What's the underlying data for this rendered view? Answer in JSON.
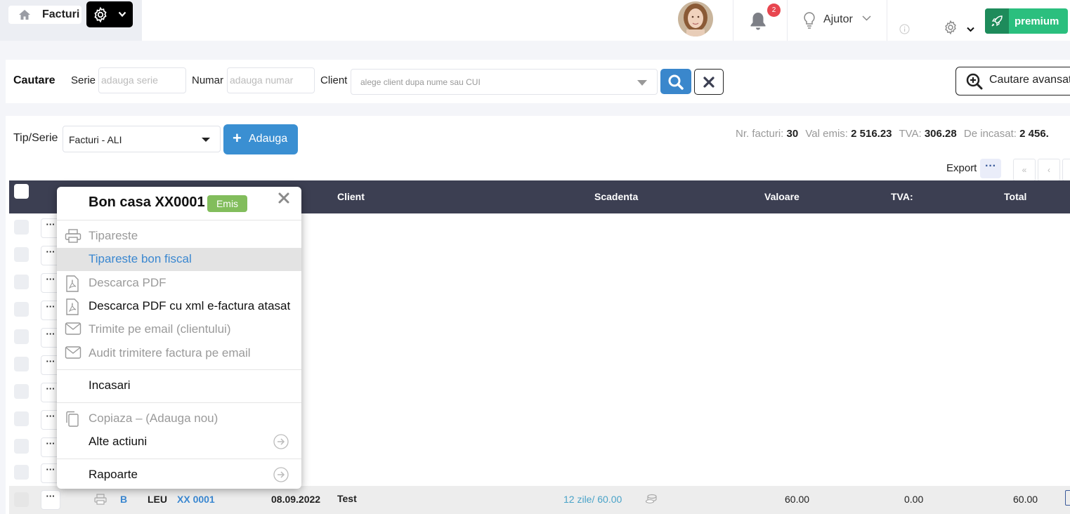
{
  "header": {
    "home_title": "Facturi",
    "notifications_count": "2",
    "help_label": "Ajutor",
    "premium_label": "premium"
  },
  "search": {
    "title": "Cautare",
    "serie_label": "Serie",
    "serie_placeholder": "adauga serie",
    "numar_label": "Numar",
    "numar_placeholder": "adauga numar",
    "client_label": "Client",
    "client_placeholder": "alege client dupa nume sau CUI",
    "advanced_label": "Cautare avansata"
  },
  "toolbar": {
    "tip_label": "Tip/Serie",
    "tip_value": "Facturi - ALI",
    "add_label": "Adauga",
    "export_label": "Export",
    "export_dots": "···",
    "pager_first": "«",
    "pager_prev": "‹"
  },
  "stats": {
    "nr_label": "Nr. facturi:",
    "nr_value": "30",
    "val_label": "Val emis:",
    "val_value": "2 516.23",
    "tva_label": "TVA:",
    "tva_value": "306.28",
    "incasat_label": "De incasat:",
    "incasat_value": "2 456."
  },
  "table": {
    "columns": [
      "Client",
      "Scadenta",
      "Valoare",
      "TVA:",
      "Total"
    ],
    "row_dots": "···",
    "last_row": {
      "type": "B",
      "currency": "LEU",
      "number": "XX 0001",
      "date": "08.09.2022",
      "client": "Test",
      "due": "12 zile/ 60.00",
      "valoare": "60.00",
      "tva": "0.00",
      "total": "60.00"
    }
  },
  "menu": {
    "title": "Bon casa XX0001",
    "status": "Emis",
    "items": [
      {
        "label": "Tipareste",
        "icon": "printer-icon",
        "state": "disabled"
      },
      {
        "label": "Tipareste bon fiscal",
        "icon": "",
        "state": "highlighted"
      },
      {
        "label": "Descarca PDF",
        "icon": "pdf-icon",
        "state": "disabled"
      },
      {
        "label": "Descarca PDF cu xml e-factura atasat",
        "icon": "pdf-icon",
        "state": "enabled"
      },
      {
        "label": "Trimite pe email (clientului)",
        "icon": "envelope-icon",
        "state": "disabled"
      },
      {
        "label": "Audit trimitere factura pe email",
        "icon": "envelope-icon",
        "state": "disabled"
      },
      {
        "label": "Incasari",
        "icon": "",
        "state": "enabled"
      },
      {
        "label": "Copiaza – (Adauga nou)",
        "icon": "copy-icon",
        "state": "disabled"
      },
      {
        "label": "Alte actiuni",
        "icon": "arrow-right-icon",
        "state": "enabled"
      },
      {
        "label": "Rapoarte",
        "icon": "arrow-right-icon",
        "state": "enabled"
      }
    ]
  },
  "colors": {
    "header_dark": "#3c3f52",
    "primary_blue": "#3a8fd2",
    "premium_green": "#2bbf7e",
    "status_green": "#82bd5c",
    "badge_red": "#e8464f"
  }
}
